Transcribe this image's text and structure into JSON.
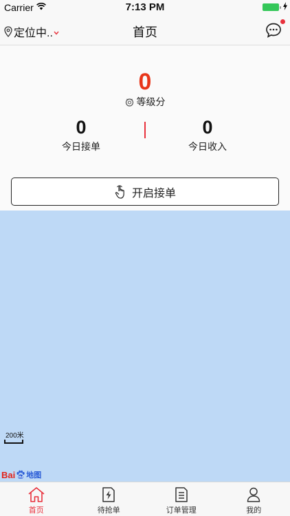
{
  "status_bar": {
    "carrier": "Carrier",
    "time": "7:13 PM"
  },
  "nav": {
    "location": "定位中..",
    "title": "首页"
  },
  "stats": {
    "score": "0",
    "level_label": "等级分",
    "left_value": "0",
    "left_label": "今日接单",
    "right_value": "0",
    "right_label": "今日收入"
  },
  "start_button": {
    "label": "开启接单"
  },
  "map": {
    "scale_label": "200米",
    "logo_text_left": "Bai",
    "logo_text_right": "地图"
  },
  "tabs": [
    {
      "label": "首页",
      "icon": "home-icon",
      "active": true
    },
    {
      "label": "待抢单",
      "icon": "bolt-document-icon",
      "active": false
    },
    {
      "label": "订单管理",
      "icon": "document-list-icon",
      "active": false
    },
    {
      "label": "我的",
      "icon": "person-icon",
      "active": false
    }
  ],
  "colors": {
    "accent": "#e8303c",
    "score": "#e8361a",
    "map": "#bed9f6"
  }
}
